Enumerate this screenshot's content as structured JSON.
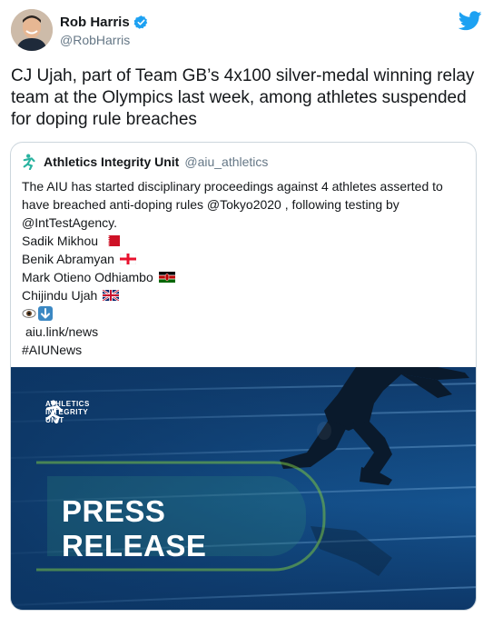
{
  "author": {
    "display_name": "Rob Harris",
    "handle": "@RobHarris",
    "avatar_icon": "person-avatar",
    "verified_icon": "verified-badge-icon"
  },
  "tweet_text": "CJ Ujah, part of Team GB’s 4x100 silver-medal winning relay team at the Olympics last week, among athletes suspended for doping rule breaches",
  "quoted": {
    "display_name": "Athletics Integrity Unit",
    "handle": "@aiu_athletics",
    "intro": "The AIU has started disciplinary proceedings against 4 athletes asserted to have breached anti-doping rules @Tokyo2020 , following testing by @IntTestAgency.",
    "athletes": [
      {
        "name": "Sadik Mikhou",
        "flag": "bahrain-flag"
      },
      {
        "name": "Benik Abramyan",
        "flag": "georgia-flag"
      },
      {
        "name": "Mark Otieno Odhiambo",
        "flag": "kenya-flag"
      },
      {
        "name": "Chijindu Ujah",
        "flag": "uk-flag"
      }
    ],
    "emojis": [
      "eye-emoji",
      "down-arrow-emoji"
    ],
    "link": "aiu.link/news",
    "hashtag": "#AIUNews",
    "media": {
      "brand_line1": "ATHLETICS",
      "brand_line2": "INTEGRITY",
      "brand_line3": "UNIT",
      "press_line1": "PRESS",
      "press_line2": "RELEASE"
    }
  },
  "colors": {
    "twitter_blue": "#1da1f2",
    "text": "#14171a",
    "secondary": "#657786",
    "aiu_teal": "#2ab3a0",
    "media_blue": "#15538f",
    "accent_green": "#7ac143"
  }
}
